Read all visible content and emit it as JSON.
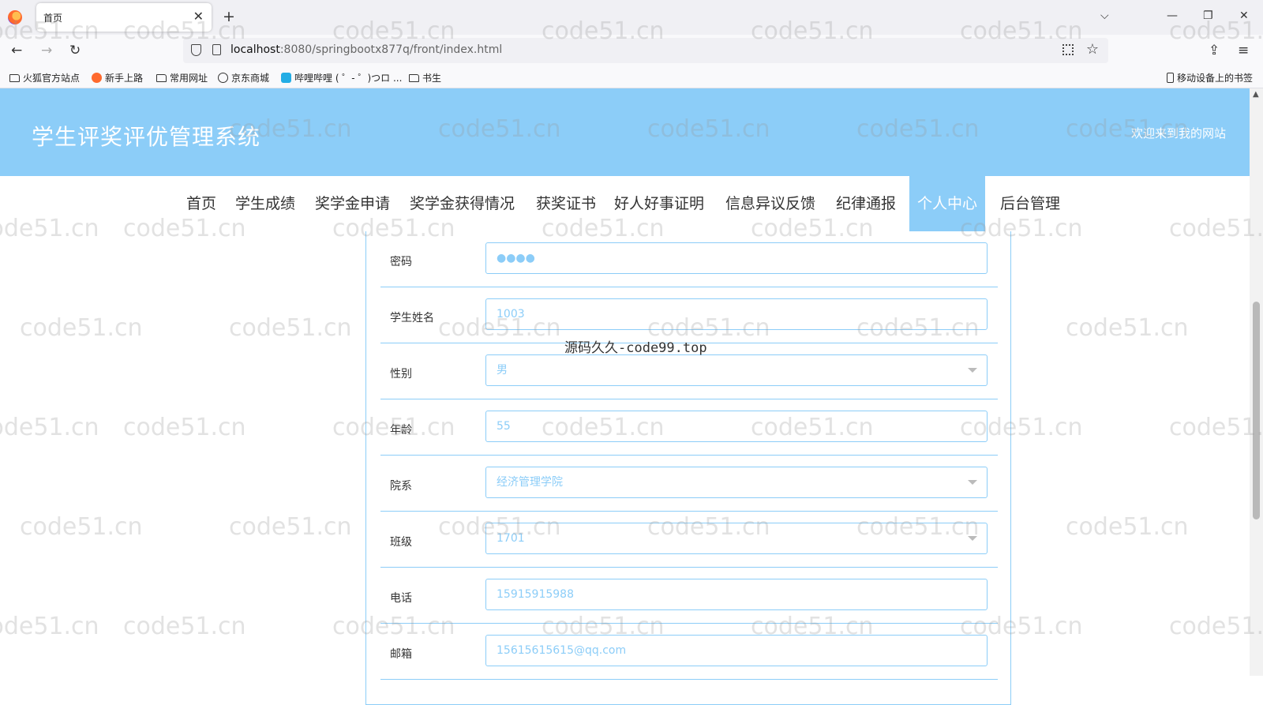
{
  "browser": {
    "tab_title": "首页",
    "url_host": "localhost",
    "url_rest": ":8080/springbootx877q/front/index.html",
    "bookmarks": [
      "火狐官方站点",
      "新手上路",
      "常用网址",
      "京东商城",
      "哔哩哔哩 ( ゜- ゜)つロ ...",
      "书生"
    ],
    "mobile_bookmarks": "移动设备上的书签"
  },
  "site": {
    "title": "学生评奖评优管理系统",
    "welcome": "欢迎来到我的网站"
  },
  "menu": [
    "首页",
    "学生成绩",
    "奖学金申请",
    "奖学金获得情况",
    "获奖证书",
    "好人好事证明",
    "信息异议反馈",
    "纪律通报",
    "个人中心",
    "后台管理"
  ],
  "form": {
    "password_label": "密码",
    "password_value": "●●●●",
    "name_label": "学生姓名",
    "name_value": "1003",
    "gender_label": "性别",
    "gender_value": "男",
    "age_label": "年龄",
    "age_value": "55",
    "dept_label": "院系",
    "dept_value": "经济管理学院",
    "class_label": "班级",
    "class_value": "1701",
    "phone_label": "电话",
    "phone_value": "15915915988",
    "email_label": "邮箱",
    "email_value": "15615615615@qq.com"
  },
  "watermark": {
    "center": "源码久久-code99.top",
    "repeat": "code51.cn"
  },
  "colors": {
    "accent": "#8ccdf8"
  }
}
